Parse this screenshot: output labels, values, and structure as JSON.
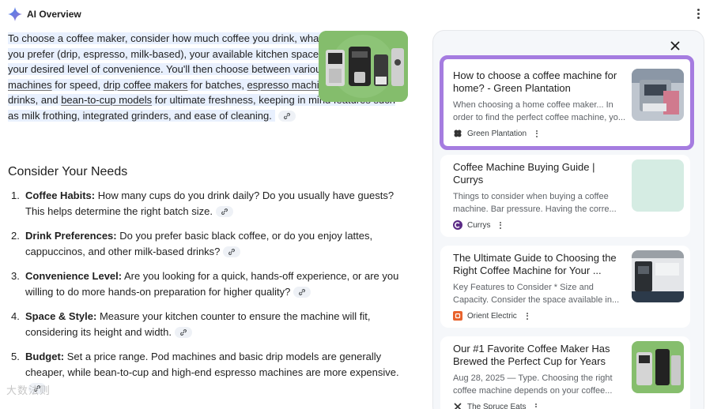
{
  "header": {
    "title": "AI Overview",
    "icon": "sparkle-icon"
  },
  "summary": {
    "part1": "To choose a coffee maker, consider how much coffee you drink, what types of drinks you prefer (drip, espresso, milk-based), your available kitchen space, your budget, and your desired level of convenience",
    "part2": ". You'll then choose between various types like ",
    "link1": "pod machines",
    "part3": " for speed, ",
    "link2": "drip coffee makers",
    "part4": " for batches, ",
    "link3": "espresso machines",
    "part5": " for specialty drinks, and ",
    "link4": "bean-to-cup models",
    "part6": " for ultimate freshness, keeping in mind features such as milk frothing, integrated grinders, and ease of cleaning."
  },
  "section_title": "Consider Your Needs",
  "needs": [
    {
      "num": "1.",
      "label": "Coffee Habits:",
      "text": " How many cups do you drink daily? Do you usually have guests? This helps determine the right batch size."
    },
    {
      "num": "2.",
      "label": "Drink Preferences:",
      "text": " Do you prefer basic black coffee, or do you enjoy lattes, cappuccinos, and other milk-based drinks?"
    },
    {
      "num": "3.",
      "label": "Convenience Level:",
      "text": " Are you looking for a quick, hands-off experience, or are you willing to do more hands-on preparation for higher quality?"
    },
    {
      "num": "4.",
      "label": "Space & Style:",
      "text": " Measure your kitchen counter to ensure the machine will fit, considering its height and width."
    },
    {
      "num": "5.",
      "label": "Budget:",
      "text": " Set a price range. Pod machines and basic drip models are generally cheaper, while bean-to-cup and high-end espresso machines are more expensive."
    }
  ],
  "sources": [
    {
      "title": "How to choose a coffee machine for home? - Green Plantation",
      "snippet": "When choosing a home coffee maker... In order to find the perfect coffee machine, yo...",
      "site": "Green Plantation",
      "favicon_color": "#333333"
    },
    {
      "title": "Coffee Machine Buying Guide | Currys",
      "snippet": "Things to consider when buying a coffee machine. Bar pressure. Having the corre...",
      "site": "Currys",
      "favicon_color": "#5b2a86"
    },
    {
      "title": "The Ultimate Guide to Choosing the Right Coffee Machine for Your ...",
      "snippet": "Key Features to Consider * Size and Capacity. Consider the space available in...",
      "site": "Orient Electric",
      "favicon_color": "#e8622c"
    },
    {
      "title": "Our #1 Favorite Coffee Maker Has Brewed the Perfect Cup for Years",
      "snippet": "Aug 28, 2025 — Type. Choosing the right coffee machine depends on your coffee...",
      "site": "The Spruce Eats",
      "favicon_color": "#333333"
    }
  ],
  "watermark": "大数法则",
  "colors": {
    "highlight": "#e8f0fe",
    "active_border": "#a57ce0",
    "panel_bg": "#f5f7fa"
  }
}
